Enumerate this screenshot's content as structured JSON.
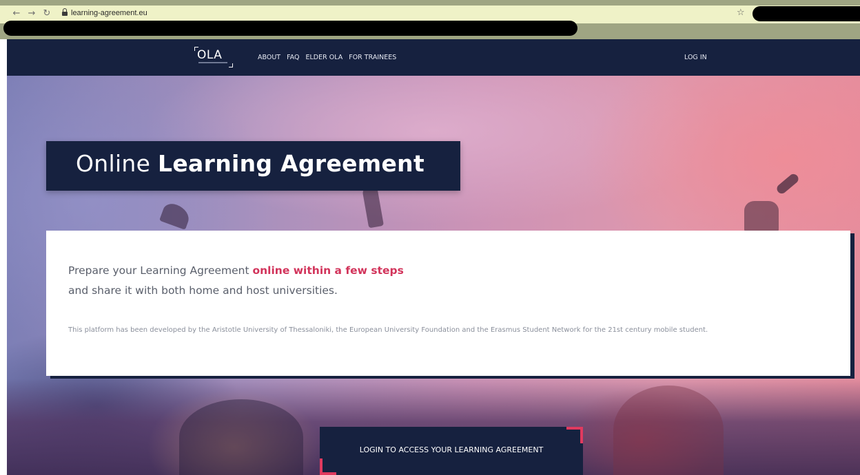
{
  "browser": {
    "back_icon": "back-arrow-icon",
    "forward_icon": "forward-arrow-icon",
    "reload_icon": "reload-icon",
    "url": "learning-agreement.eu",
    "bookmark_icon": "star-icon"
  },
  "header": {
    "logo_text": "OLA",
    "nav": [
      {
        "label": "ABOUT"
      },
      {
        "label": "FAQ"
      },
      {
        "label": "ELDER OLA"
      },
      {
        "label": "FOR TRAINEES"
      }
    ],
    "login_label": "LOG IN"
  },
  "hero": {
    "title_light": "Online ",
    "title_bold": "Learning Agreement"
  },
  "info": {
    "lead_text": "Prepare your Learning Agreement ",
    "lead_highlight": "online within a few steps",
    "sub_text": "and share it with both home and host universities.",
    "description": "This platform has been developed by the Aristotle University of Thessaloniki, the European University Foundation and the Erasmus Student Network for the 21st century mobile student."
  },
  "cta": {
    "label": "LOGIN TO ACCESS YOUR LEARNING AGREEMENT"
  },
  "colors": {
    "navy": "#16213f",
    "accent": "#d2345b",
    "cta_corner": "#e03a5f"
  }
}
